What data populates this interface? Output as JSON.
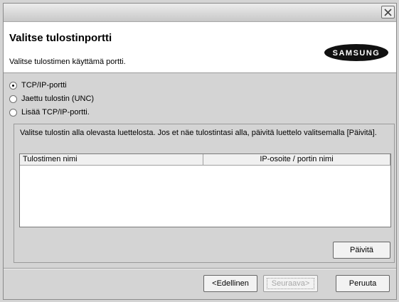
{
  "header": {
    "title": "Valitse tulostinportti",
    "subtitle": "Valitse tulostimen käyttämä portti.",
    "logo_text": "SAMSUNG"
  },
  "options": [
    {
      "label": "TCP/IP-portti",
      "checked": true
    },
    {
      "label": "Jaettu tulostin (UNC)",
      "checked": false
    },
    {
      "label": "Lisää TCP/IP-portti.",
      "checked": false
    }
  ],
  "group": {
    "description": "Valitse tulostin alla olevasta luettelosta. Jos et näe tulostintasi alla, päivitä luettelo valitsemalla [Päivitä].",
    "columns": [
      "Tulostimen nimi",
      "IP-osoite / portin nimi"
    ],
    "refresh_label": "Päivitä"
  },
  "footer": {
    "back_label": "<Edellinen",
    "next_label": "Seuraava>",
    "cancel_label": "Peruuta"
  }
}
